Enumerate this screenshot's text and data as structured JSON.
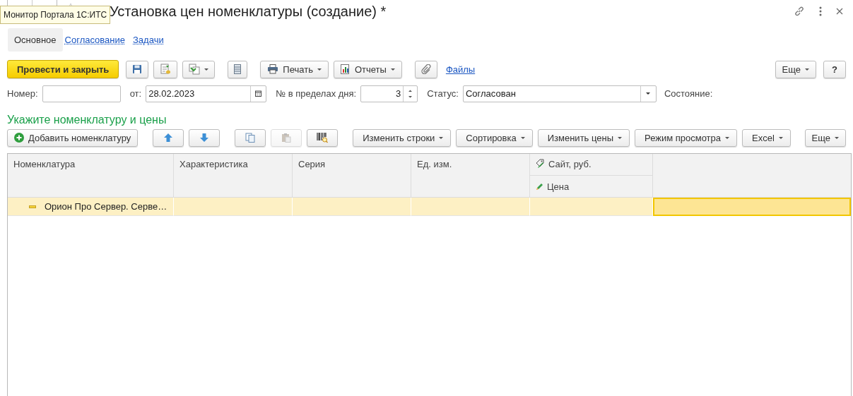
{
  "window": {
    "title": "Установка цен номенклатуры (создание) *",
    "tooltip": "Монитор Портала 1С:ИТС"
  },
  "tabs": [
    {
      "label": "Основное",
      "selected": true
    },
    {
      "label": "Согласование",
      "selected": false
    },
    {
      "label": "Задачи",
      "selected": false
    }
  ],
  "toolbar": {
    "primary": "Провести и закрыть",
    "print": "Печать",
    "reports": "Отчеты",
    "files": "Файлы",
    "more": "Еще",
    "help": "?"
  },
  "fields": {
    "number": {
      "label": "Номер:"
    },
    "date": {
      "label": "от:",
      "value": "28.02.2023"
    },
    "day_number": {
      "label": "№ в пределах дня:",
      "value": "3"
    },
    "status": {
      "label": "Статус:",
      "value": "Согласован"
    },
    "state": {
      "label": "Состояние:"
    }
  },
  "section_title": "Укажите номенклатуру и цены",
  "table_toolbar": {
    "add": "Добавить номенклатуру",
    "paste_disabled": true,
    "menus": [
      "Изменить строки",
      "Сортировка",
      "Изменить цены",
      "Режим просмотра",
      "Excel"
    ],
    "more": "Еще"
  },
  "table": {
    "columns": [
      "Номенклатура",
      "Характеристика",
      "Серия",
      "Ед. изм."
    ],
    "price_column": {
      "title": "Сайт, руб.",
      "subtitle": "Цена"
    },
    "rows": [
      {
        "selected": true,
        "cells": [
          {
            "text": "Орион Про Сервер. Серве…",
            "selected": false
          },
          {
            "selected": false
          },
          {
            "selected": false
          },
          {
            "selected": false
          },
          {
            "selected": false
          },
          {
            "selected": true
          }
        ]
      }
    ]
  }
}
